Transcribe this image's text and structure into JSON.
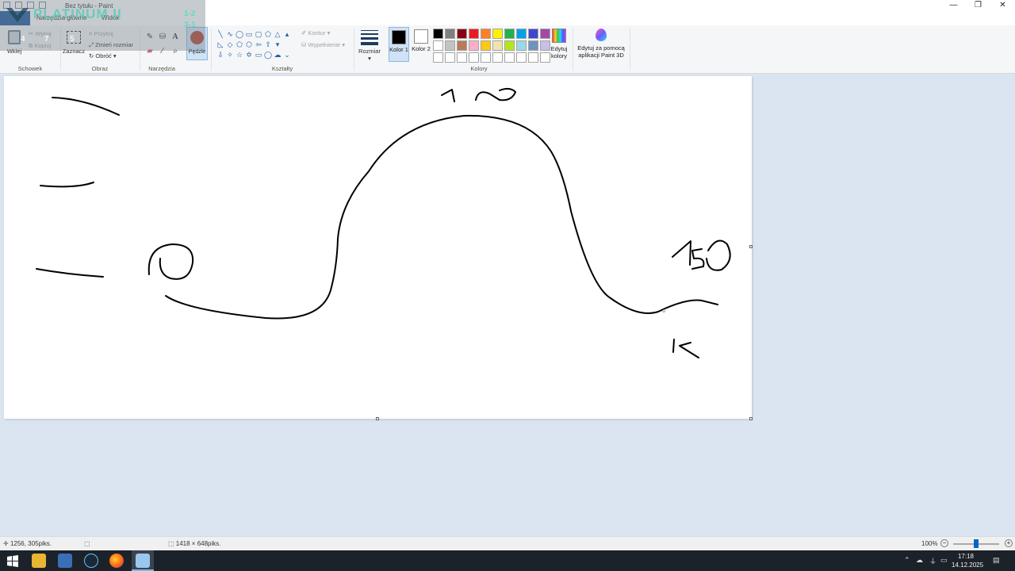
{
  "window": {
    "title": "Bez tytułu - Paint",
    "controls": [
      "—",
      "❐",
      "✕"
    ]
  },
  "tabs": {
    "home": "Narzędzia główne",
    "view": "Widok"
  },
  "overlay": {
    "brand": "PLATINUM II",
    "digits": [
      "4",
      "7",
      "5"
    ],
    "value_top": "1-2",
    "value_mid": "3-1"
  },
  "ribbon": {
    "clipboard": {
      "paste": "Wklej",
      "cut": "Wytnij",
      "copy": "Kopiuj",
      "label": "Schowek"
    },
    "image": {
      "select": "Zaznacz",
      "crop": "Przytnij",
      "resize": "Zmień rozmiar",
      "rotate": "Obróć",
      "label": "Obraz"
    },
    "tools": {
      "label": "Narzędzia",
      "brushes": "Pędzle"
    },
    "shapes": {
      "outline": "Kontur",
      "fill": "Wypełnienie",
      "label": "Kształty"
    },
    "size": {
      "label": "Rozmiar"
    },
    "colors": {
      "color1": "Kolor 1",
      "color2": "Kolor 2",
      "edit": "Edytuj kolory",
      "label": "Kolory",
      "color1_value": "#000000",
      "color2_value": "#ffffff",
      "palette": [
        "#000000",
        "#7f7f7f",
        "#880015",
        "#ed1c24",
        "#ff7f27",
        "#fff200",
        "#22b14c",
        "#00a2e8",
        "#3f48cc",
        "#a349a4",
        "#ffffff",
        "#c3c3c3",
        "#b97a57",
        "#ffaec9",
        "#ffc90e",
        "#efe4b0",
        "#b5e61d",
        "#99d9ea",
        "#7092be",
        "#c8bfe7",
        "#ffffff",
        "#ffffff",
        "#ffffff",
        "#ffffff",
        "#ffffff",
        "#ffffff",
        "#ffffff",
        "#ffffff",
        "#ffffff",
        "#ffffff"
      ]
    },
    "paint3d": {
      "label": "Edytuj za pomocą aplikacji Paint 3D"
    }
  },
  "status": {
    "cursor_pos": "1256, 305piks.",
    "canvas_size": "1418 × 648piks.",
    "zoom": "100%"
  },
  "taskbar": {
    "time": "17:18",
    "date": "14.12.2025"
  }
}
